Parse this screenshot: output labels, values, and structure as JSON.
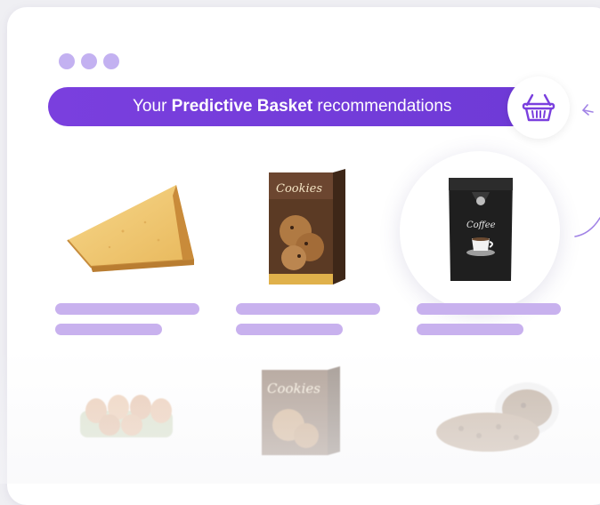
{
  "window": {
    "dots": [
      "dot",
      "dot",
      "dot"
    ]
  },
  "banner": {
    "prefix": "Your ",
    "bold": "Predictive Basket",
    "suffix": " recommendations"
  },
  "icons": {
    "basket": "basket-icon"
  },
  "products": [
    {
      "name": "cheese",
      "icon": "cheese-wedge-image"
    },
    {
      "name": "cookies",
      "icon": "cookies-box-image",
      "box_text": "Cookies"
    },
    {
      "name": "coffee",
      "icon": "coffee-bag-image",
      "bag_text": "Coffee"
    }
  ],
  "products_faded": [
    {
      "name": "eggs",
      "icon": "eggs-carton-image"
    },
    {
      "name": "cookies",
      "icon": "cookies-box-image",
      "box_text": "Cookies"
    },
    {
      "name": "coffee-beans",
      "icon": "coffee-beans-bowl-image"
    }
  ],
  "colors": {
    "banner": "#7742dc",
    "dots": "#c3b1f1",
    "placeholder_bars": "#c8b1ee"
  }
}
